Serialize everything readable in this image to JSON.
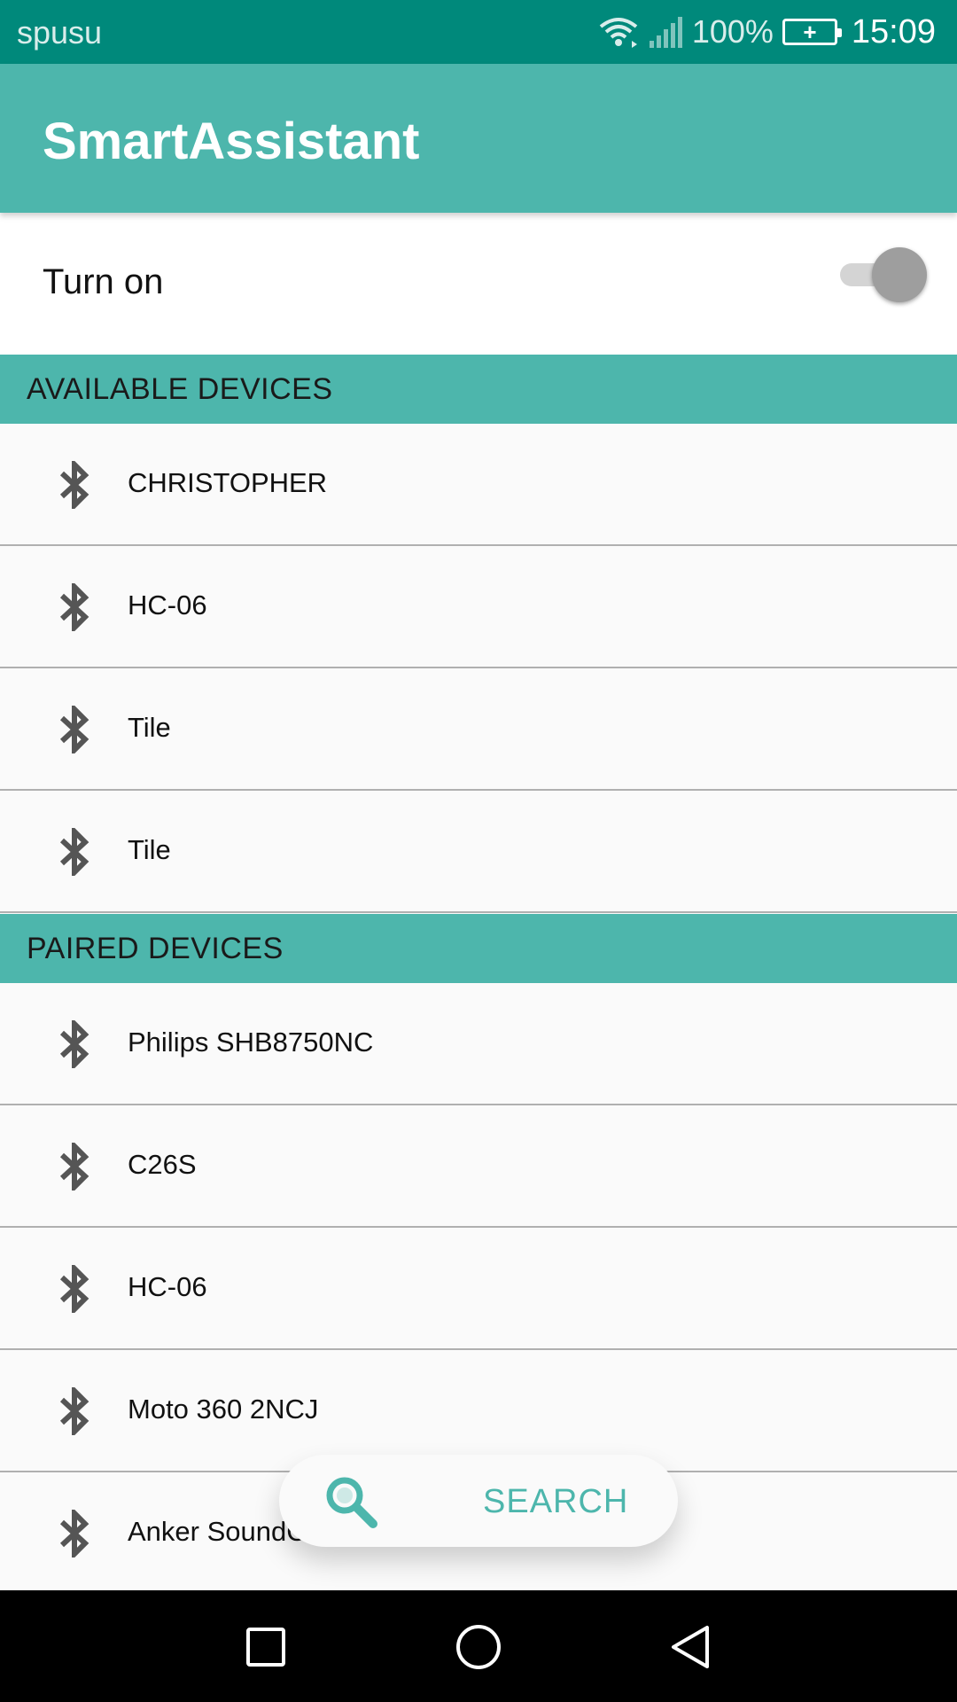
{
  "status_bar": {
    "carrier": "spusu",
    "battery_percent": "100%",
    "time": "15:09",
    "icons": [
      "wifi-icon",
      "signal-icon",
      "battery-charging-icon"
    ]
  },
  "app_bar": {
    "title": "SmartAssistant"
  },
  "toggle": {
    "label": "Turn on",
    "state": "off"
  },
  "available_devices": {
    "header": "AVAILABLE DEVICES",
    "items": [
      {
        "name": "CHRISTOPHER",
        "icon": "bluetooth-icon"
      },
      {
        "name": "HC-06",
        "icon": "bluetooth-icon"
      },
      {
        "name": "Tile",
        "icon": "bluetooth-icon"
      },
      {
        "name": "Tile",
        "icon": "bluetooth-icon"
      }
    ]
  },
  "paired_devices": {
    "header": "PAIRED DEVICES",
    "items": [
      {
        "name": "Philips SHB8750NC",
        "icon": "bluetooth-icon"
      },
      {
        "name": "C26S",
        "icon": "bluetooth-icon"
      },
      {
        "name": "HC-06",
        "icon": "bluetooth-icon"
      },
      {
        "name": "Moto 360 2NCJ",
        "icon": "bluetooth-icon"
      },
      {
        "name": "Anker SoundCore",
        "icon": "bluetooth-icon"
      }
    ]
  },
  "search_button": {
    "label": "SEARCH",
    "icon": "search-icon"
  },
  "nav_bar": {
    "buttons": [
      "recents-icon",
      "home-icon",
      "back-icon"
    ]
  },
  "colors": {
    "status_bar": "#00897b",
    "accent": "#4db6ac",
    "background": "#fafafa"
  }
}
